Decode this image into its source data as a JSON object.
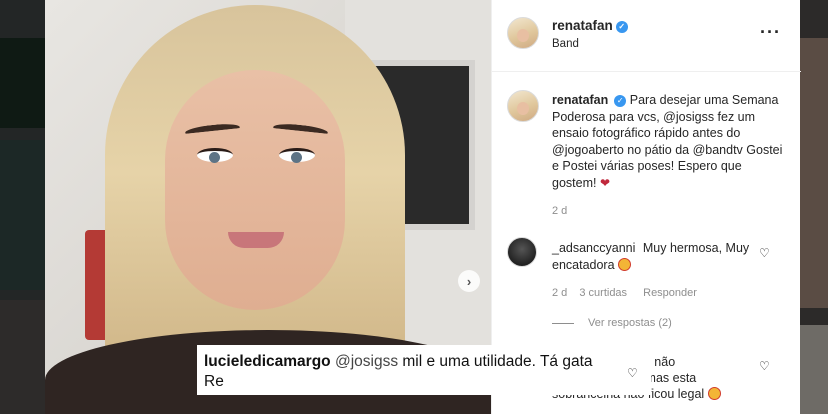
{
  "post": {
    "username": "renatafan",
    "location": "Band",
    "more_icon": "more-options-icon"
  },
  "caption": {
    "username": "renatafan",
    "text": "Para desejar uma Semana Poderosa para vcs, @josigss fez um ensaio fotográfico rápido antes do @jogoaberto no pátio da @bandtv Gostei e Postei várias poses! Espero que gostem!",
    "emoji": "broken-heart-emoji",
    "age": "2 d"
  },
  "comments": [
    {
      "username": "_adsanccyanni",
      "text": "Muy hermosa, Muy encatadora",
      "emoji": "smiling-face-emoji",
      "age": "2 d",
      "likes": "3 curtidas",
      "reply_label": "Responder",
      "view_replies": "Ver respostas (2)"
    },
    {
      "text_line1": "linda e não",
      "text_line2": "es\"... mas esta",
      "text_line3": "sobrancelha não ficou legal"
    }
  ],
  "subtitle_overlay": {
    "username": "lucieledicamargo",
    "mention": "@josigss",
    "text": "mil e uma utilidade. Tá gata",
    "line2": "Re"
  },
  "icons": {
    "verified": "verified-badge-icon",
    "next": "chevron-right-icon",
    "like": "heart-outline-icon"
  }
}
